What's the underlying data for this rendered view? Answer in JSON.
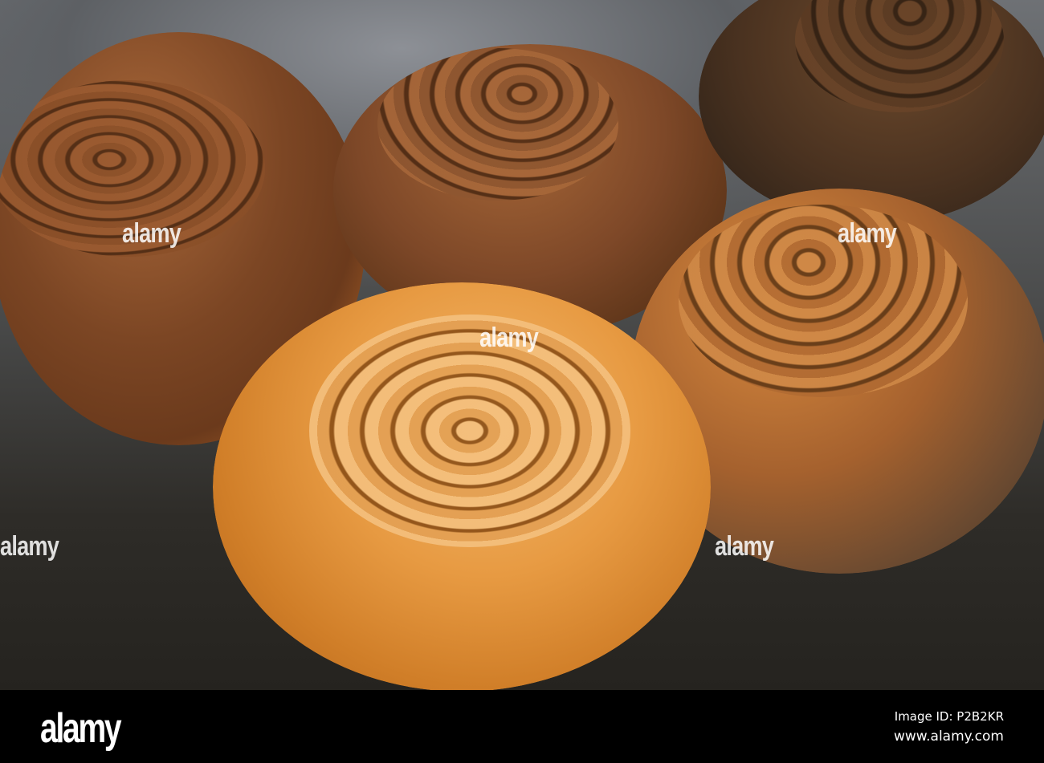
{
  "photo": {
    "subject": "snail shells",
    "watermark": "alamy"
  },
  "footer": {
    "logo": "alamy",
    "image_id": "Image ID: P2B2KR",
    "url": "www.alamy.com"
  }
}
